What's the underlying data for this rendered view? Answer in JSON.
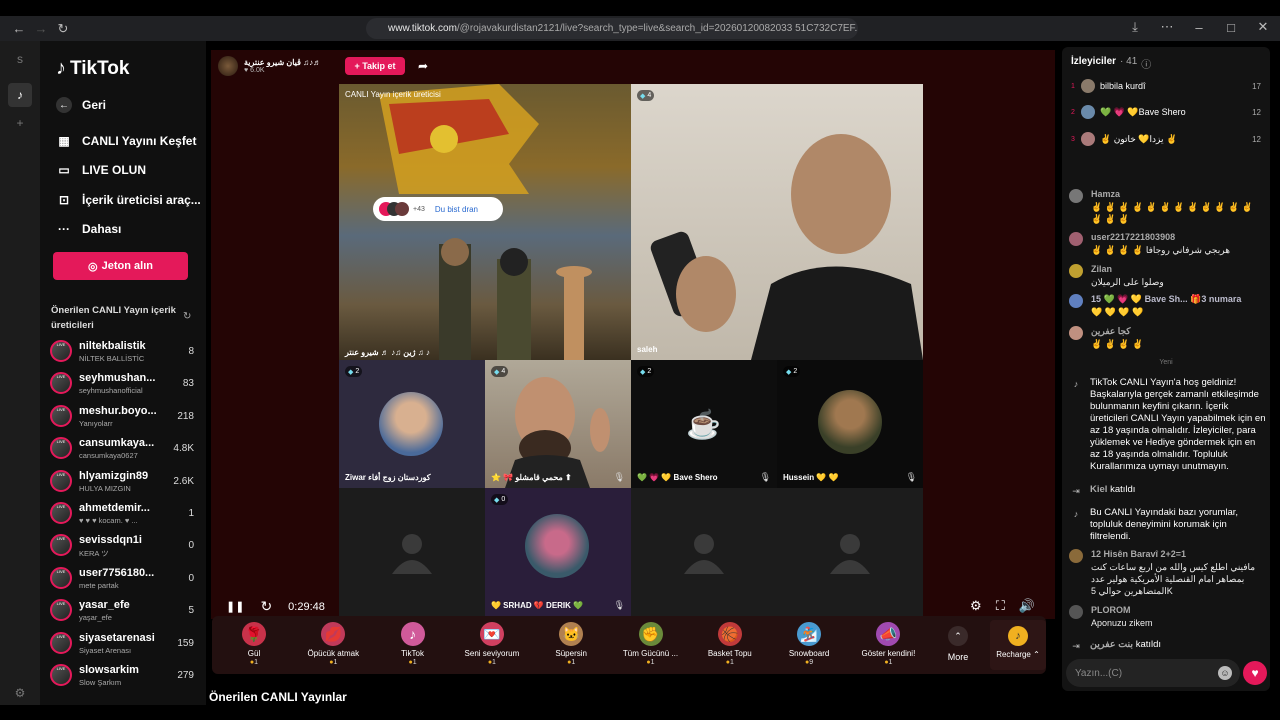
{
  "browser": {
    "url_host": "www.tiktok.com",
    "url_path": "/@rojavakurdistan2121/live?search_type=live&search_id=20260120082033 51C732C7EF..."
  },
  "sidebar": {
    "logo": "TikTok",
    "back": "Geri",
    "nav": [
      {
        "label": "CANLI Yayını Keşfet",
        "icon": "live-calendar-icon"
      },
      {
        "label": "LIVE OLUN",
        "icon": "video-camera-icon"
      },
      {
        "label": "İçerik üreticisi araç...",
        "icon": "creator-tools-icon"
      },
      {
        "label": "Dahası",
        "icon": "more-dots-icon"
      }
    ],
    "jeton_button": "Jeton alın",
    "suggest_title": "Önerilen CANLI Yayın içerik üreticileri",
    "suggested": [
      {
        "name": "niltekbalistik",
        "sub": "NİLTEK BALLİSTİC",
        "count": "8"
      },
      {
        "name": "seyhmushan...",
        "sub": "seyhmushanofficial",
        "count": "83"
      },
      {
        "name": "meshur.boyo...",
        "sub": "Yanıyolarr",
        "count": "218"
      },
      {
        "name": "cansumkaya...",
        "sub": "cansumkaya0627",
        "count": "4.8K"
      },
      {
        "name": "hlyamizgin89",
        "sub": "HULYA MIZGIN",
        "count": "2.6K"
      },
      {
        "name": "ahmetdemir...",
        "sub": "♥ ♥ ♥ kocam. ♥ ...",
        "count": "1"
      },
      {
        "name": "sevissdqn1i",
        "sub": "KERA ツ",
        "count": "0"
      },
      {
        "name": "user7756180...",
        "sub": "mete partak",
        "count": "0"
      },
      {
        "name": "yasar_efe",
        "sub": "yaşar_efe",
        "count": "5"
      },
      {
        "name": "siyasetarenasi",
        "sub": "Siyaset Arenası",
        "count": "159"
      },
      {
        "name": "slowsarkim",
        "sub": "Slow Şarkım",
        "count": "279"
      }
    ],
    "live_tag": "LIVE"
  },
  "stream": {
    "host_name": "ڤیان شیرو عنترية ♫♪♬",
    "host_likes": "♥ 6.0K",
    "follow": "+ Takip et",
    "host_tile_label": "CANLI Yayın içerik üreticisi",
    "host_tile_caption": "ژین ♫♪ ♬ شیرو عنتر ♫ ♪",
    "join_count": "+43",
    "join_text": "Du bist dran",
    "tiles": [
      {
        "badge": "4",
        "label": "saleh"
      },
      {
        "badge": "2",
        "label": "Ziwar کوردستان زوج أفاء"
      },
      {
        "badge": "4",
        "label": "⭐ 🎀 محمي قامشلو ⬆"
      },
      {
        "badge": "2",
        "label": "💚 💗 💛 Bave Shero"
      },
      {
        "badge": "2",
        "label": "Hussein 💛 💛"
      },
      {
        "badge": "0",
        "label": "💛 SRHAD 💔 DERIK 💚"
      }
    ],
    "time": "0:29:48"
  },
  "gifts": [
    {
      "name": "Gül",
      "price": "1",
      "icon": "🌹",
      "color": "#c8324a"
    },
    {
      "name": "Öpücük atmak",
      "price": "1",
      "icon": "💋",
      "color": "#c03a5a"
    },
    {
      "name": "TikTok",
      "price": "1",
      "icon": "♪",
      "color": "#d05a9a"
    },
    {
      "name": "Seni seviyorum",
      "price": "1",
      "icon": "💌",
      "color": "#d04060"
    },
    {
      "name": "Süpersin",
      "price": "1",
      "icon": "🐱",
      "color": "#b08050"
    },
    {
      "name": "Tüm Gücünü ...",
      "price": "1",
      "icon": "✊",
      "color": "#6a8a3a"
    },
    {
      "name": "Basket Topu",
      "price": "1",
      "icon": "🏀",
      "color": "#c03a3a"
    },
    {
      "name": "Snowboard",
      "price": "9",
      "icon": "🏂",
      "color": "#4a9ad0"
    },
    {
      "name": "Göster kendini!",
      "price": "1",
      "icon": "📣",
      "color": "#a04ab0"
    }
  ],
  "more_label": "More",
  "recharge_label": "Recharge ⌃",
  "bottom_title": "Önerilen CANLI Yayınlar",
  "chat": {
    "viewers_label": "İzleyiciler",
    "viewers_count": "· 41",
    "top_viewers": [
      {
        "rank": "1",
        "name": "bilbila kurdî",
        "score": "17"
      },
      {
        "rank": "2",
        "name": "💚 💗 💛Bave Shero",
        "score": "12"
      },
      {
        "rank": "3",
        "name": "✌ يزدا💛 خاتون ✌",
        "score": "12"
      }
    ],
    "messages": [
      {
        "user": "Hamza",
        "text": "✌ ✌ ✌ ✌ ✌ ✌ ✌ ✌ ✌ ✌ ✌ ✌ ✌ ✌ ✌"
      },
      {
        "user": "user2217221803908",
        "text": "✌ ✌ ✌ ✌ هربجي شرفاني روجافا"
      },
      {
        "user": "Zilan",
        "text": "وصلوا على الرميلان"
      },
      {
        "user": "15 💚 💗 💛 Bave Sh...   🎁3 numara",
        "text": "💛 💛 💛 💛"
      },
      {
        "user": "كجا عفرين",
        "text": "✌ ✌ ✌ ✌"
      }
    ],
    "divider": "Yeni",
    "welcome": "TikTok CANLI Yayın'a hoş geldiniz! Başkalarıyla gerçek zamanlı etkileşimde bulunmanın keyfini çıkarın. İçerik üreticileri CANLI Yayın yapabilmek için en az 18 yaşında olmalıdır. İzleyiciler, para yüklemek ve Hediye göndermek için en az 18 yaşında olmalıdır. Topluluk Kurallarımıza uymayı unutmayın.",
    "joined1_user": "Kiel",
    "joined_text": "katıldı",
    "filter_notice": "Bu CANLI Yayındaki bazı yorumlar, topluluk deneyimini korumak için filtrelendi.",
    "msg_hisen_user": "12 Hisên Baravî 2+2=1",
    "msg_hisen_text": "مافيني اطلع كيس والله من اربع ساعات كنت بمصاهر امام القنصلية الأمريكية هولير عدد المتضاهرين حوالي 5K",
    "msg_plorom_user": "PLOROM",
    "msg_plorom_text": "Aponuzu zikem",
    "joined2_user": "بنت عفرين",
    "input_placeholder": "Yazın...(C)"
  }
}
